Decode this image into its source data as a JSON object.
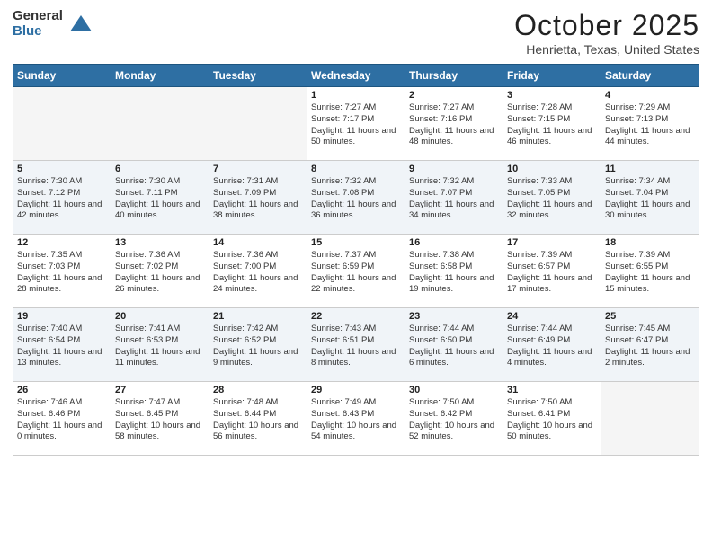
{
  "logo": {
    "general": "General",
    "blue": "Blue"
  },
  "title": "October 2025",
  "location": "Henrietta, Texas, United States",
  "days_of_week": [
    "Sunday",
    "Monday",
    "Tuesday",
    "Wednesday",
    "Thursday",
    "Friday",
    "Saturday"
  ],
  "weeks": [
    [
      {
        "day": "",
        "empty": true
      },
      {
        "day": "",
        "empty": true
      },
      {
        "day": "",
        "empty": true
      },
      {
        "day": "1",
        "sunrise": "7:27 AM",
        "sunset": "7:17 PM",
        "daylight": "11 hours and 50 minutes."
      },
      {
        "day": "2",
        "sunrise": "7:27 AM",
        "sunset": "7:16 PM",
        "daylight": "11 hours and 48 minutes."
      },
      {
        "day": "3",
        "sunrise": "7:28 AM",
        "sunset": "7:15 PM",
        "daylight": "11 hours and 46 minutes."
      },
      {
        "day": "4",
        "sunrise": "7:29 AM",
        "sunset": "7:13 PM",
        "daylight": "11 hours and 44 minutes."
      }
    ],
    [
      {
        "day": "5",
        "sunrise": "7:30 AM",
        "sunset": "7:12 PM",
        "daylight": "11 hours and 42 minutes."
      },
      {
        "day": "6",
        "sunrise": "7:30 AM",
        "sunset": "7:11 PM",
        "daylight": "11 hours and 40 minutes."
      },
      {
        "day": "7",
        "sunrise": "7:31 AM",
        "sunset": "7:09 PM",
        "daylight": "11 hours and 38 minutes."
      },
      {
        "day": "8",
        "sunrise": "7:32 AM",
        "sunset": "7:08 PM",
        "daylight": "11 hours and 36 minutes."
      },
      {
        "day": "9",
        "sunrise": "7:32 AM",
        "sunset": "7:07 PM",
        "daylight": "11 hours and 34 minutes."
      },
      {
        "day": "10",
        "sunrise": "7:33 AM",
        "sunset": "7:05 PM",
        "daylight": "11 hours and 32 minutes."
      },
      {
        "day": "11",
        "sunrise": "7:34 AM",
        "sunset": "7:04 PM",
        "daylight": "11 hours and 30 minutes."
      }
    ],
    [
      {
        "day": "12",
        "sunrise": "7:35 AM",
        "sunset": "7:03 PM",
        "daylight": "11 hours and 28 minutes."
      },
      {
        "day": "13",
        "sunrise": "7:36 AM",
        "sunset": "7:02 PM",
        "daylight": "11 hours and 26 minutes."
      },
      {
        "day": "14",
        "sunrise": "7:36 AM",
        "sunset": "7:00 PM",
        "daylight": "11 hours and 24 minutes."
      },
      {
        "day": "15",
        "sunrise": "7:37 AM",
        "sunset": "6:59 PM",
        "daylight": "11 hours and 22 minutes."
      },
      {
        "day": "16",
        "sunrise": "7:38 AM",
        "sunset": "6:58 PM",
        "daylight": "11 hours and 19 minutes."
      },
      {
        "day": "17",
        "sunrise": "7:39 AM",
        "sunset": "6:57 PM",
        "daylight": "11 hours and 17 minutes."
      },
      {
        "day": "18",
        "sunrise": "7:39 AM",
        "sunset": "6:55 PM",
        "daylight": "11 hours and 15 minutes."
      }
    ],
    [
      {
        "day": "19",
        "sunrise": "7:40 AM",
        "sunset": "6:54 PM",
        "daylight": "11 hours and 13 minutes."
      },
      {
        "day": "20",
        "sunrise": "7:41 AM",
        "sunset": "6:53 PM",
        "daylight": "11 hours and 11 minutes."
      },
      {
        "day": "21",
        "sunrise": "7:42 AM",
        "sunset": "6:52 PM",
        "daylight": "11 hours and 9 minutes."
      },
      {
        "day": "22",
        "sunrise": "7:43 AM",
        "sunset": "6:51 PM",
        "daylight": "11 hours and 8 minutes."
      },
      {
        "day": "23",
        "sunrise": "7:44 AM",
        "sunset": "6:50 PM",
        "daylight": "11 hours and 6 minutes."
      },
      {
        "day": "24",
        "sunrise": "7:44 AM",
        "sunset": "6:49 PM",
        "daylight": "11 hours and 4 minutes."
      },
      {
        "day": "25",
        "sunrise": "7:45 AM",
        "sunset": "6:47 PM",
        "daylight": "11 hours and 2 minutes."
      }
    ],
    [
      {
        "day": "26",
        "sunrise": "7:46 AM",
        "sunset": "6:46 PM",
        "daylight": "11 hours and 0 minutes."
      },
      {
        "day": "27",
        "sunrise": "7:47 AM",
        "sunset": "6:45 PM",
        "daylight": "10 hours and 58 minutes."
      },
      {
        "day": "28",
        "sunrise": "7:48 AM",
        "sunset": "6:44 PM",
        "daylight": "10 hours and 56 minutes."
      },
      {
        "day": "29",
        "sunrise": "7:49 AM",
        "sunset": "6:43 PM",
        "daylight": "10 hours and 54 minutes."
      },
      {
        "day": "30",
        "sunrise": "7:50 AM",
        "sunset": "6:42 PM",
        "daylight": "10 hours and 52 minutes."
      },
      {
        "day": "31",
        "sunrise": "7:50 AM",
        "sunset": "6:41 PM",
        "daylight": "10 hours and 50 minutes."
      },
      {
        "day": "",
        "empty": true
      }
    ]
  ],
  "labels": {
    "sunrise": "Sunrise:",
    "sunset": "Sunset:",
    "daylight": "Daylight:"
  }
}
